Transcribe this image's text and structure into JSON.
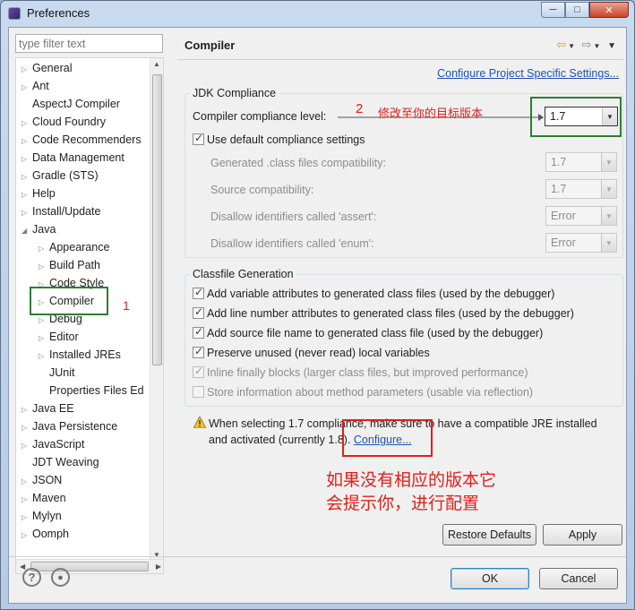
{
  "window": {
    "title": "Preferences",
    "minimize": "─",
    "maximize": "□",
    "close": "✕"
  },
  "filter": {
    "placeholder": "type filter text"
  },
  "tree": [
    {
      "label": "General",
      "indent": 0,
      "arrow": "▷"
    },
    {
      "label": "Ant",
      "indent": 0,
      "arrow": "▷"
    },
    {
      "label": "AspectJ Compiler",
      "indent": 0,
      "arrow": ""
    },
    {
      "label": "Cloud Foundry",
      "indent": 0,
      "arrow": "▷"
    },
    {
      "label": "Code Recommenders",
      "indent": 0,
      "arrow": "▷"
    },
    {
      "label": "Data Management",
      "indent": 0,
      "arrow": "▷"
    },
    {
      "label": "Gradle (STS)",
      "indent": 0,
      "arrow": "▷"
    },
    {
      "label": "Help",
      "indent": 0,
      "arrow": "▷"
    },
    {
      "label": "Install/Update",
      "indent": 0,
      "arrow": "▷"
    },
    {
      "label": "Java",
      "indent": 0,
      "arrow": "◢"
    },
    {
      "label": "Appearance",
      "indent": 1,
      "arrow": "▷"
    },
    {
      "label": "Build Path",
      "indent": 1,
      "arrow": "▷"
    },
    {
      "label": "Code Style",
      "indent": 1,
      "arrow": "▷"
    },
    {
      "label": "Compiler",
      "indent": 1,
      "arrow": "▷"
    },
    {
      "label": "Debug",
      "indent": 1,
      "arrow": "▷"
    },
    {
      "label": "Editor",
      "indent": 1,
      "arrow": "▷"
    },
    {
      "label": "Installed JREs",
      "indent": 1,
      "arrow": "▷"
    },
    {
      "label": "JUnit",
      "indent": 1,
      "arrow": ""
    },
    {
      "label": "Properties Files Ed",
      "indent": 1,
      "arrow": ""
    },
    {
      "label": "Java EE",
      "indent": 0,
      "arrow": "▷"
    },
    {
      "label": "Java Persistence",
      "indent": 0,
      "arrow": "▷"
    },
    {
      "label": "JavaScript",
      "indent": 0,
      "arrow": "▷"
    },
    {
      "label": "JDT Weaving",
      "indent": 0,
      "arrow": ""
    },
    {
      "label": "JSON",
      "indent": 0,
      "arrow": "▷"
    },
    {
      "label": "Maven",
      "indent": 0,
      "arrow": "▷"
    },
    {
      "label": "Mylyn",
      "indent": 0,
      "arrow": "▷"
    },
    {
      "label": "Oomph",
      "indent": 0,
      "arrow": "▷"
    }
  ],
  "page": {
    "title": "Compiler",
    "configure_project_link": "Configure Project Specific Settings..."
  },
  "jdk": {
    "legend": "JDK Compliance",
    "level_label": "Compiler compliance level:",
    "level_value": "1.7",
    "use_default_label": "Use default compliance settings",
    "generated_label": "Generated .class files compatibility:",
    "generated_value": "1.7",
    "source_label": "Source compatibility:",
    "source_value": "1.7",
    "assert_label": "Disallow identifiers called 'assert':",
    "assert_value": "Error",
    "enum_label": "Disallow identifiers called 'enum':",
    "enum_value": "Error"
  },
  "classfile": {
    "legend": "Classfile Generation",
    "items": [
      {
        "label": "Add variable attributes to generated class files (used by the debugger)",
        "checked": true,
        "disabled": false
      },
      {
        "label": "Add line number attributes to generated class files (used by the debugger)",
        "checked": true,
        "disabled": false
      },
      {
        "label": "Add source file name to generated class file (used by the debugger)",
        "checked": true,
        "disabled": false
      },
      {
        "label": "Preserve unused (never read) local variables",
        "checked": true,
        "disabled": false
      },
      {
        "label": "Inline finally blocks (larger class files, but improved performance)",
        "checked": true,
        "disabled": true
      },
      {
        "label": "Store information about method parameters (usable via reflection)",
        "checked": false,
        "disabled": true
      }
    ]
  },
  "warning": {
    "line1": "When selecting 1.7 compliance, make sure to have a compatible JRE installed",
    "line2": "and activated (currently 1.8).",
    "link": "Configure..."
  },
  "annotations": {
    "one": "1",
    "two": "2",
    "two_text": "修改至你的目标版本",
    "note_line1": "如果没有相应的版本它",
    "note_line2": "会提示你，进行配置"
  },
  "buttons": {
    "restore": "Restore Defaults",
    "apply": "Apply",
    "ok": "OK",
    "cancel": "Cancel"
  },
  "footer": {
    "help_icon": "?",
    "record_icon": "●"
  },
  "colors": {
    "annotation_red": "#e0201a",
    "annotation_green": "#2e7d32",
    "link": "#1a53b5"
  }
}
